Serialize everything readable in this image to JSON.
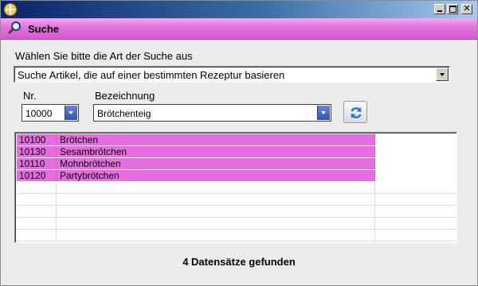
{
  "window": {
    "title": ""
  },
  "header": {
    "title": "Suche"
  },
  "form": {
    "instruction": "Wählen Sie bitte die Art der Suche aus",
    "search_mode_value": "Suche Artikel, die auf einer bestimmten Rezeptur basieren",
    "nr_label": "Nr.",
    "nr_value": "10000",
    "bezeichnung_label": "Bezeichnung",
    "bezeichnung_value": "Brötchenteig"
  },
  "results": {
    "rows": [
      {
        "nr": "10100",
        "name": "Brötchen"
      },
      {
        "nr": "10130",
        "name": "Sesambrötchen"
      },
      {
        "nr": "10110",
        "name": "Mohnbrötchen"
      },
      {
        "nr": "10120",
        "name": "Partybrötchen"
      }
    ]
  },
  "status": {
    "text": "4 Datensätze gefunden"
  },
  "colors": {
    "accent": "#e46ee0",
    "header_bar": "#d45ad0",
    "title_bar": "#0a246a"
  },
  "icons": {
    "app": "app-logo-icon",
    "header": "search-icon",
    "refresh": "refresh-icon"
  }
}
